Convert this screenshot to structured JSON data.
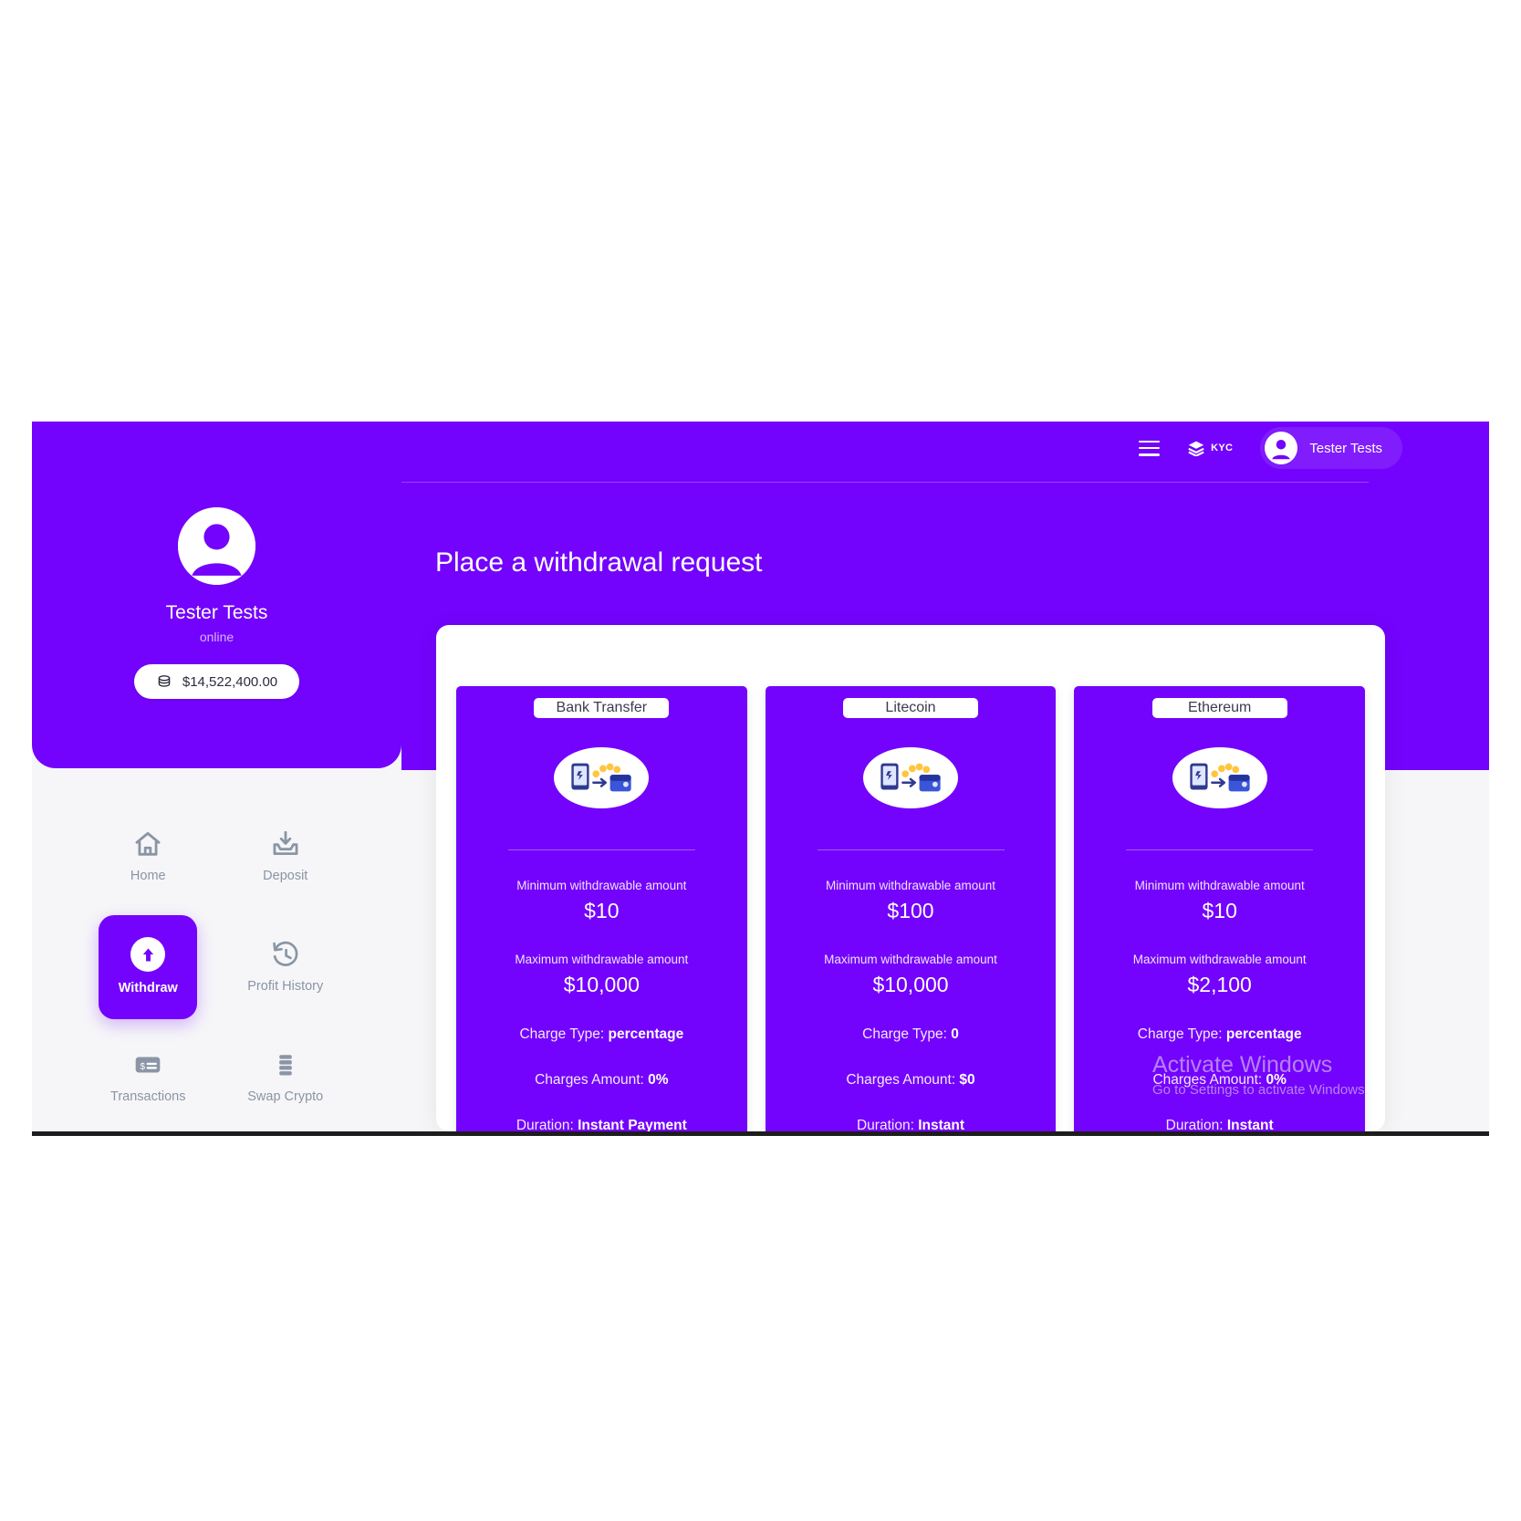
{
  "topbar": {
    "menu_icon": "hamburger-icon",
    "kyc_label": "KYC",
    "kyc_icon": "layers-icon",
    "user_name": "Tester Tests",
    "user_avatar_icon": "user-avatar-icon"
  },
  "sidebar": {
    "avatar_icon": "user-avatar-icon",
    "profile_name": "Tester Tests",
    "status": "online",
    "balance_icon": "coins-icon",
    "balance": "$14,522,400.00",
    "items": [
      {
        "label": "Home",
        "icon": "home-icon",
        "active": false
      },
      {
        "label": "Deposit",
        "icon": "deposit-inbox-icon",
        "active": false
      },
      {
        "label": "Withdraw",
        "icon": "arrow-up-circle-icon",
        "active": true
      },
      {
        "label": "Profit History",
        "icon": "clock-history-icon",
        "active": false
      },
      {
        "label": "Transactions",
        "icon": "card-receipt-icon",
        "active": false
      },
      {
        "label": "Swap Crypto",
        "icon": "stack-layers-icon",
        "active": false
      }
    ]
  },
  "main": {
    "page_title": "Place a withdrawal request",
    "cards": [
      {
        "tab": "Bank Transfer",
        "illustration_icon": "phone-to-wallet-transfer-icon",
        "min_label": "Minimum withdrawable amount",
        "min_value": "$10",
        "max_label": "Maximum withdrawable amount",
        "max_value": "$10,000",
        "charge_type_label": "Charge Type:",
        "charge_type_value": "percentage",
        "charges_label": "Charges Amount:",
        "charges_value": "0%",
        "duration_label": "Duration:",
        "duration_value": "Instant Payment"
      },
      {
        "tab": "Litecoin",
        "illustration_icon": "phone-to-wallet-transfer-icon",
        "min_label": "Minimum withdrawable amount",
        "min_value": "$100",
        "max_label": "Maximum withdrawable amount",
        "max_value": "$10,000",
        "charge_type_label": "Charge Type:",
        "charge_type_value": "0",
        "charges_label": "Charges Amount:",
        "charges_value": "$0",
        "duration_label": "Duration:",
        "duration_value": "Instant"
      },
      {
        "tab": "Ethereum",
        "illustration_icon": "phone-to-wallet-transfer-icon",
        "min_label": "Minimum withdrawable amount",
        "min_value": "$10",
        "max_label": "Maximum withdrawable amount",
        "max_value": "$2,100",
        "charge_type_label": "Charge Type:",
        "charge_type_value": "percentage",
        "charges_label": "Charges Amount:",
        "charges_value": "0%",
        "duration_label": "Duration:",
        "duration_value": "Instant"
      }
    ]
  },
  "watermark": {
    "line1": "Activate Windows",
    "line2": "Go to Settings to activate Windows."
  },
  "colors": {
    "brand_purple": "#7303fc",
    "page_bg": "#f6f6f8",
    "muted_text": "#8a95a5"
  }
}
